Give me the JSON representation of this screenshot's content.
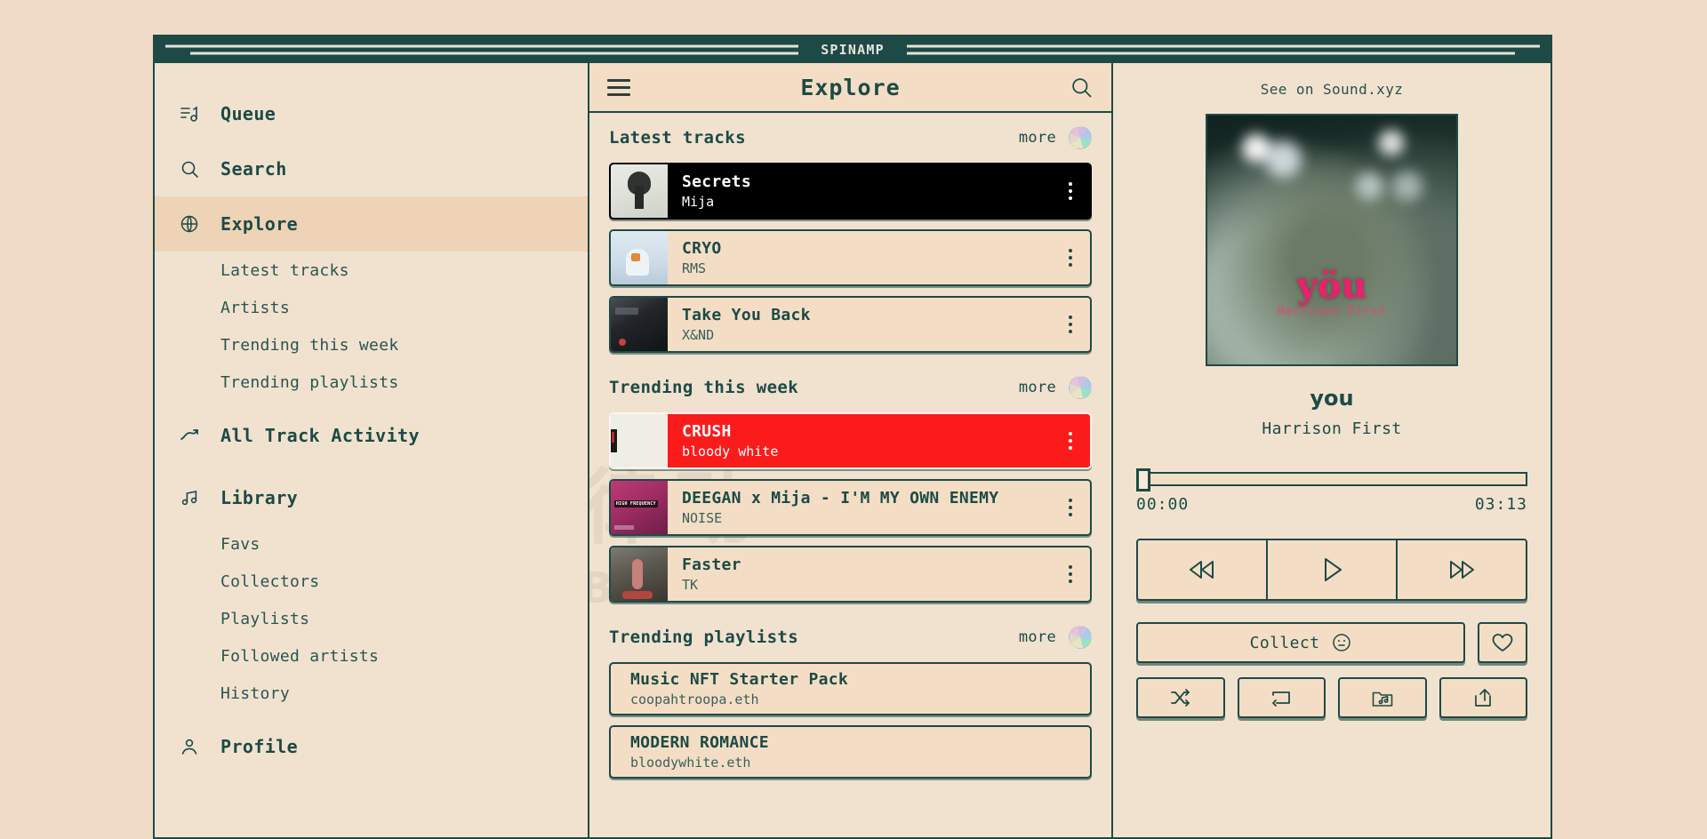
{
  "window": {
    "title": "SPINAMP"
  },
  "colors": {
    "accent_dark": "#1d4a46",
    "page_bg": "#f0dcc6",
    "panel_bg": "#f1e2d0",
    "card_bg": "#f3dec5",
    "active_nav_bg": "#eed3b6",
    "row_playing_dark": "#000000",
    "row_playing_red": "#fb1b1b"
  },
  "sidebar": {
    "groups": [
      {
        "icon": "queue-list-icon",
        "label": "Queue",
        "active": false,
        "children": []
      },
      {
        "icon": "search-icon",
        "label": "Search",
        "active": false,
        "children": []
      },
      {
        "icon": "globe-icon",
        "label": "Explore",
        "active": true,
        "children": [
          "Latest tracks",
          "Artists",
          "Trending this week",
          "Trending playlists"
        ]
      },
      {
        "icon": "trend-up-icon",
        "label": "All Track Activity",
        "active": false,
        "children": []
      },
      {
        "icon": "music-note-icon",
        "label": "Library",
        "active": false,
        "children": [
          "Favs",
          "Collectors",
          "Playlists",
          "Followed artists",
          "History"
        ]
      },
      {
        "icon": "user-icon",
        "label": "Profile",
        "active": false,
        "children": []
      }
    ]
  },
  "middle": {
    "menu_icon": "hamburger-icon",
    "title": "Explore",
    "search_icon": "search-icon",
    "more_label": "more",
    "sections": [
      {
        "title": "Latest tracks",
        "kind": "tracks",
        "items": [
          {
            "title": "Secrets",
            "artist": "Mija",
            "state": "playing-dark"
          },
          {
            "title": "CRYO",
            "artist": "RMS",
            "state": ""
          },
          {
            "title": "Take You Back",
            "artist": "X&ND",
            "state": ""
          }
        ]
      },
      {
        "title": "Trending this week",
        "kind": "tracks",
        "items": [
          {
            "title": "CRUSH",
            "artist": "bloody white",
            "state": "playing-red"
          },
          {
            "title": "DEEGAN x Mija - I'M MY OWN ENEMY",
            "artist": "NOISE",
            "state": ""
          },
          {
            "title": "Faster",
            "artist": "TK",
            "state": ""
          }
        ]
      },
      {
        "title": "Trending playlists",
        "kind": "playlists",
        "items": [
          {
            "title": "Music NFT Starter Pack",
            "artist": "coopahtroopa.eth",
            "state": ""
          },
          {
            "title": "MODERN ROMANCE",
            "artist": "bloodywhite.eth",
            "state": ""
          }
        ]
      }
    ],
    "watermark": {
      "cjk": "律动",
      "latin": "BLOCKBEATS"
    }
  },
  "player": {
    "see_on_label": "See on Sound.xyz",
    "cover": {
      "word": "yöu",
      "sub": "Harrison First"
    },
    "now_playing_title": "you",
    "now_playing_artist": "Harrison First",
    "time_elapsed": "00:00",
    "time_total": "03:13",
    "seek_percent": 0,
    "transport": [
      {
        "icon": "rewind-icon",
        "name": "previous-button"
      },
      {
        "icon": "play-icon",
        "name": "play-button"
      },
      {
        "icon": "fast-forward-icon",
        "name": "next-button"
      }
    ],
    "collect_label": "Collect",
    "collect_icon": "face-circle-icon",
    "fav_icon": "heart-icon",
    "utils": [
      {
        "icon": "shuffle-icon",
        "name": "shuffle-button"
      },
      {
        "icon": "repeat-icon",
        "name": "repeat-button"
      },
      {
        "icon": "add-to-playlist-icon",
        "name": "add-to-playlist-button"
      },
      {
        "icon": "share-icon",
        "name": "share-button"
      }
    ]
  }
}
